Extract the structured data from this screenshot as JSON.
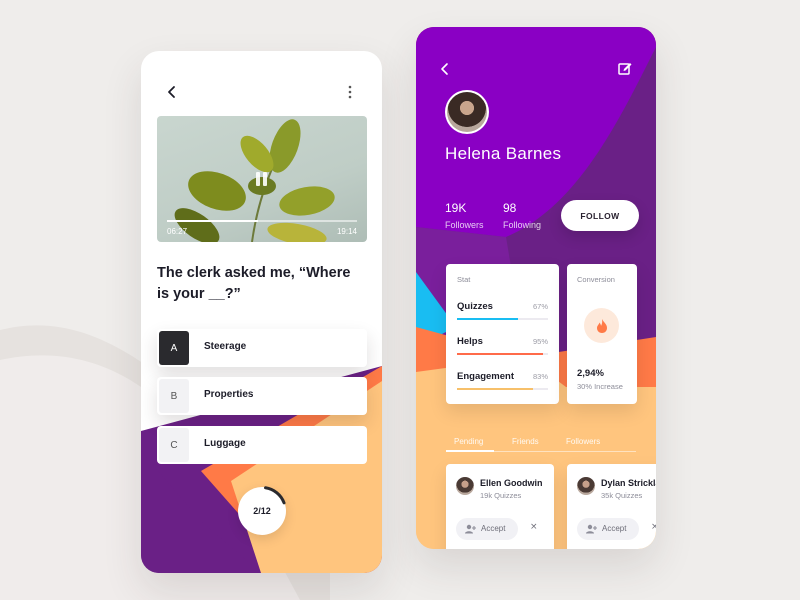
{
  "colors": {
    "purple": "#8a00c4",
    "deep_purple": "#6a2086",
    "orange": "#ff7a47",
    "peach": "#ffc57e",
    "cyan": "#19bdf2",
    "coral": "#ff6b4a",
    "gold": "#f7c06a"
  },
  "quiz": {
    "video": {
      "current_time": "06:27",
      "total_time": "19:14",
      "progress_fraction": 0.48
    },
    "question": "The clerk asked me, “Where is your __?”",
    "options": [
      {
        "key": "A",
        "label": "Steerage",
        "selected": true
      },
      {
        "key": "B",
        "label": "Properties",
        "selected": false
      },
      {
        "key": "C",
        "label": "Luggage",
        "selected": false
      }
    ],
    "counter": {
      "text": "2/12",
      "fraction": 0.17
    }
  },
  "profile": {
    "name": "Helena Barnes",
    "followers_count": "19K",
    "followers_label": "Followers",
    "following_count": "98",
    "following_label": "Following",
    "follow_button": "FOLLOW",
    "stat_card": {
      "title": "Stat",
      "rows": [
        {
          "label": "Quizzes",
          "percent": "67%",
          "value": 0.67,
          "color": "#19bdf2"
        },
        {
          "label": "Helps",
          "percent": "95%",
          "value": 0.95,
          "color": "#ff6b4a"
        },
        {
          "label": "Engagement",
          "percent": "83%",
          "value": 0.83,
          "color": "#f7c06a"
        }
      ]
    },
    "conversion_card": {
      "title": "Conversion",
      "value": "2,94%",
      "sub": "30% Increase"
    },
    "tabs": [
      "Pending",
      "Friends",
      "Followers"
    ],
    "friends": [
      {
        "name": "Ellen Goodwin",
        "sub": "19k Quizzes",
        "accept": "Accept",
        "dismiss": "×"
      },
      {
        "name": "Dylan Strickland",
        "sub": "35k Quizzes",
        "accept": "Accept",
        "dismiss": "×"
      }
    ]
  }
}
